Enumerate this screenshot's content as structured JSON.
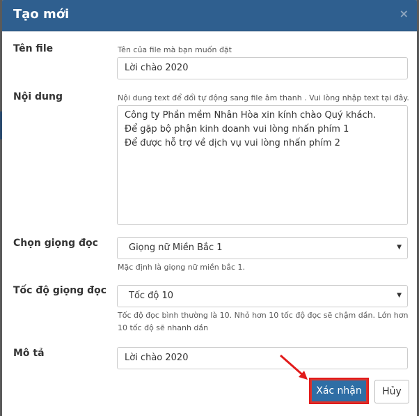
{
  "dialog": {
    "title": "Tạo mới",
    "close_icon": "×"
  },
  "fields": {
    "file_name": {
      "label": "Tên file",
      "hint": "Tên của file mà bạn muốn đặt",
      "value": "Lời chào 2020"
    },
    "content": {
      "label": "Nội dung",
      "hint": "Nội dung text để đổi tự động sang file âm thanh . Vui lòng nhập text tại đây.",
      "value": "Công ty Phần mềm Nhân Hòa xin kính chào Quý khách.\nĐể gặp bộ phận kinh doanh vui lòng nhấn phím 1\nĐể được hỗ trợ về dịch vụ vui lòng nhấn phím 2"
    },
    "voice": {
      "label": "Chọn giọng đọc",
      "selected": "Giọng nữ Miền Bắc 1",
      "hint": "Mặc định là giọng nữ miền bắc 1."
    },
    "speed": {
      "label": "Tốc độ giọng đọc",
      "selected": "Tốc độ 10",
      "hint": "Tốc độ đọc bình thường là 10. Nhỏ hơn 10 tốc độ đọc sẽ chậm dần. Lớn hơn 10 tốc độ sẽ nhanh dần"
    },
    "description": {
      "label": "Mô tả",
      "value": "Lời chào 2020"
    }
  },
  "buttons": {
    "confirm": "Xác nhận",
    "cancel": "Hủy"
  },
  "colors": {
    "header": "#2f5f8f",
    "primary_button": "#2f6ea5",
    "annotation": "#e21b1b"
  },
  "icons": {
    "close": "close-icon",
    "dropdown": "chevron-down-icon",
    "annotation_arrow": "arrow-annotation-icon"
  }
}
